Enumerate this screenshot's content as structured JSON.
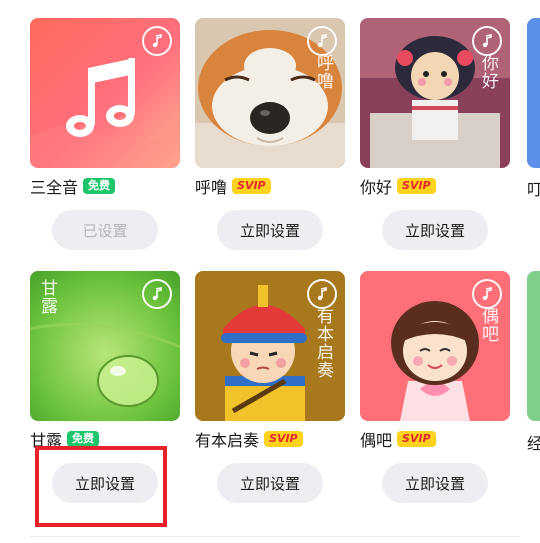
{
  "ringtones": [
    {
      "title": "三全音",
      "badge": "免费",
      "badge_type": "free",
      "button": "已设置",
      "button_state": "disabled",
      "art_text": ""
    },
    {
      "title": "呼噜",
      "badge": "SVIP",
      "badge_type": "svip",
      "button": "立即设置",
      "button_state": "enabled",
      "art_text": "呼噜"
    },
    {
      "title": "你好",
      "badge": "SVIP",
      "badge_type": "svip",
      "button": "立即设置",
      "button_state": "enabled",
      "art_text": "你好"
    },
    {
      "title": "甘露",
      "badge": "免费",
      "badge_type": "free",
      "button": "立即设置",
      "button_state": "enabled",
      "art_text": "甘露"
    },
    {
      "title": "有本启奏",
      "badge": "SVIP",
      "badge_type": "svip",
      "button": "立即设置",
      "button_state": "enabled",
      "art_text": "有本启奏"
    },
    {
      "title": "偶吧",
      "badge": "SVIP",
      "badge_type": "svip",
      "button": "立即设置",
      "button_state": "enabled",
      "art_text": "偶吧"
    }
  ],
  "peek": [
    {
      "title": "叮"
    },
    {
      "title": "经"
    }
  ],
  "highlighted_item": "ringtone-4-set-button",
  "colors": {
    "free_badge": "#1dc66a",
    "svip_badge": "#ffd21e",
    "svip_text": "#e42b2b",
    "highlight": "#e8222a",
    "button_bg": "#eceef1"
  },
  "icons": {
    "thumbnail_badge": "music-note-circle-icon",
    "cover_1": "music-note-icon"
  }
}
